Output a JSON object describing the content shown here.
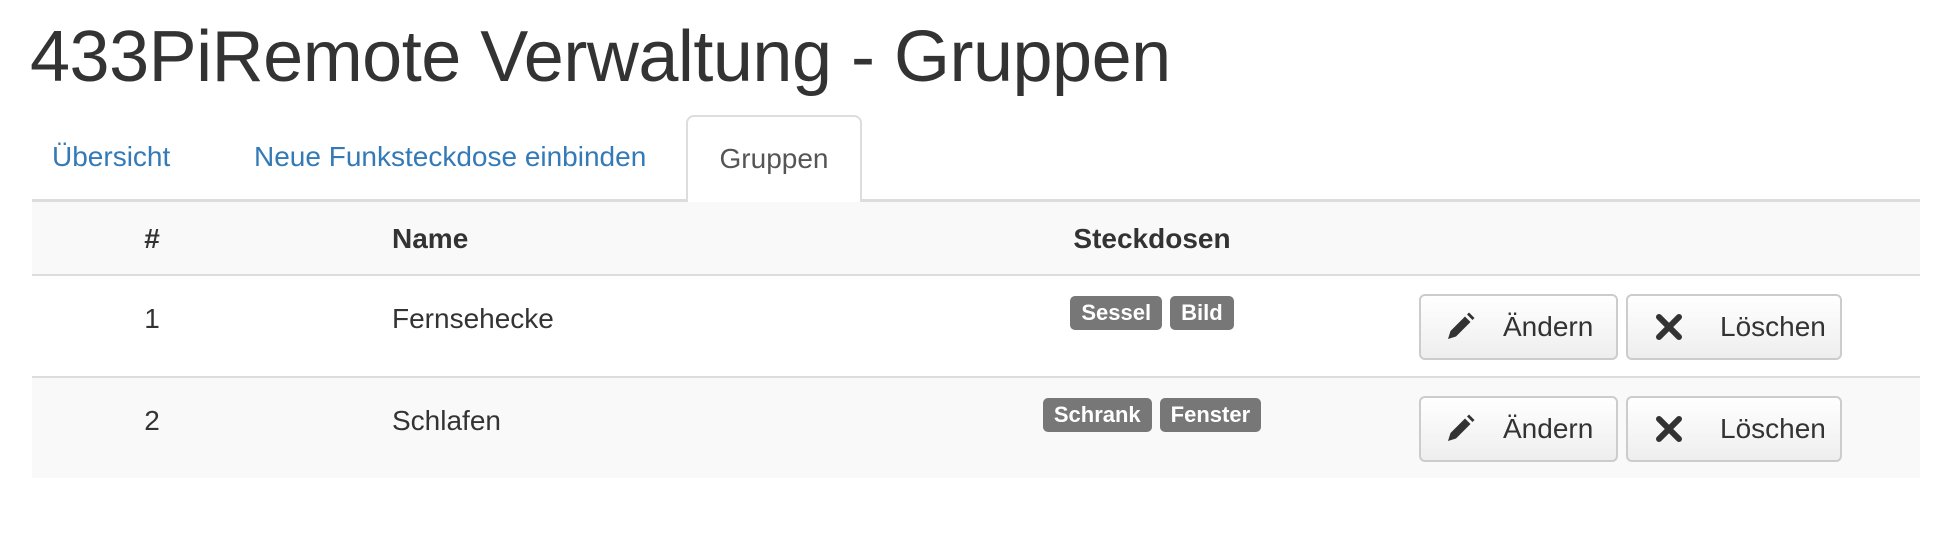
{
  "page": {
    "title": "433PiRemote Verwaltung - Gruppen"
  },
  "tabs": [
    {
      "label": "Übersicht",
      "active": false
    },
    {
      "label": "Neue Funksteckdose einbinden",
      "active": false
    },
    {
      "label": "Gruppen",
      "active": true
    }
  ],
  "table": {
    "headers": {
      "number": "#",
      "name": "Name",
      "sockets": "Steckdosen",
      "actions": ""
    },
    "rows": [
      {
        "number": "1",
        "name": "Fernsehecke",
        "sockets": [
          "Sessel",
          "Bild"
        ],
        "edit_label": "Ändern",
        "delete_label": "Löschen"
      },
      {
        "number": "2",
        "name": "Schlafen",
        "sockets": [
          "Schrank",
          "Fenster"
        ],
        "edit_label": "Ändern",
        "delete_label": "Löschen"
      }
    ]
  },
  "icons": {
    "edit": "pencil-icon",
    "delete": "close-icon"
  },
  "colors": {
    "link": "#337ab7",
    "badge": "#777777",
    "stripe": "#f9f9f9",
    "border": "#dddddd",
    "text": "#333333"
  }
}
